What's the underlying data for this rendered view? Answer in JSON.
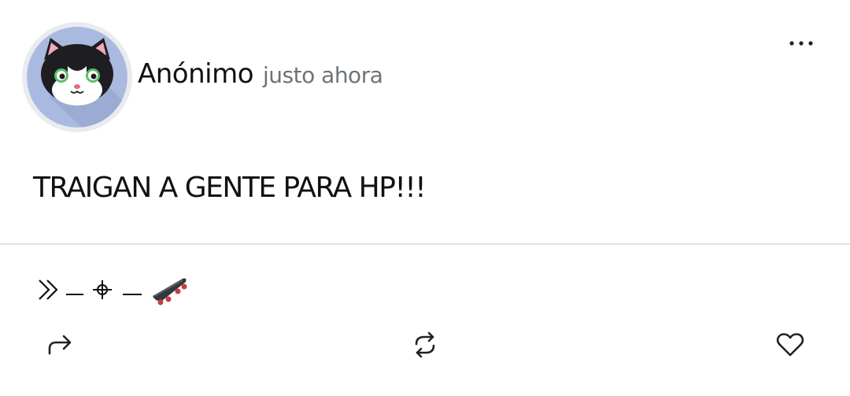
{
  "post": {
    "author": "Anónimo",
    "timestamp": "justo ahora",
    "text": "TRAIGAN A GENTE PARA HP!!!"
  },
  "header": {
    "more_icon": "more-horizontal-icon"
  },
  "avatar": {
    "description": "cat-avatar-icon",
    "bg_color": "#aab9df"
  },
  "signature": {
    "icons": [
      "double-chevron-right-icon",
      "dash",
      "crosshair-icon",
      "dash",
      "skateboard-icon"
    ]
  },
  "actions": {
    "share_icon": "share-arrow-icon",
    "repost_icon": "repost-icon",
    "like_icon": "heart-icon"
  },
  "colors": {
    "text": "#111111",
    "muted": "#6d7378",
    "divider": "#e3e3e3",
    "avatar_ring": "#e9ebef"
  }
}
